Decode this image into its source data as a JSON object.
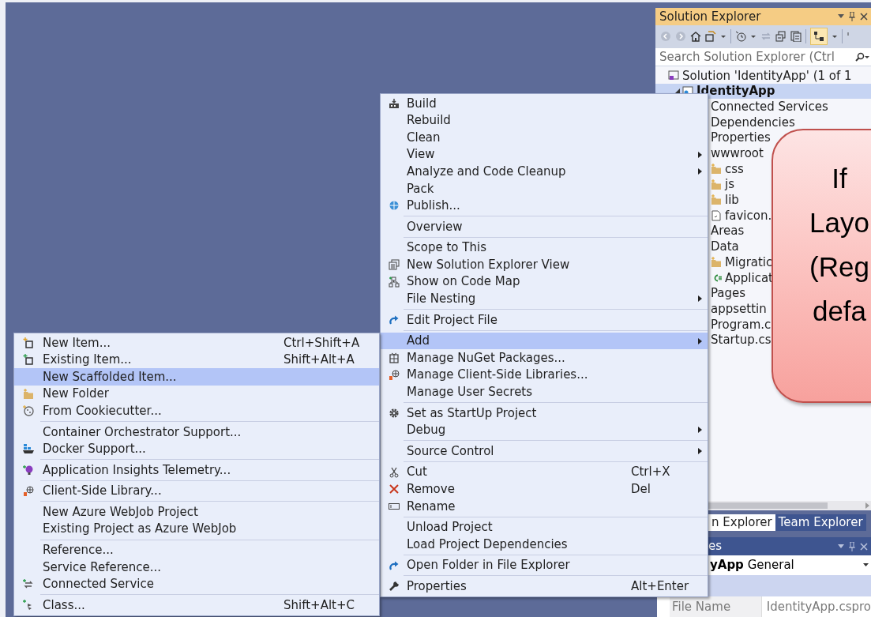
{
  "solution_explorer": {
    "title": "Solution Explorer",
    "search": {
      "placeholder": "Search Solution Explorer (Ctrl"
    },
    "tree": [
      {
        "label": "Solution 'IdentityApp' (1 of 1",
        "selected": false,
        "children": [
          {
            "label": "IdentityApp",
            "selected": true,
            "children": [
              {
                "label": "Connected Services",
                "selected": false
              },
              {
                "label": "Dependencies",
                "selected": false
              },
              {
                "label": "Properties",
                "selected": false
              },
              {
                "label": "wwwroot",
                "selected": false,
                "children": [
                  {
                    "label": "css",
                    "selected": false
                  },
                  {
                    "label": "js",
                    "selected": false
                  },
                  {
                    "label": "lib",
                    "selected": false
                  },
                  {
                    "label": "favicon.",
                    "selected": false
                  }
                ]
              },
              {
                "label": "Areas",
                "selected": false
              },
              {
                "label": "Data",
                "selected": false,
                "children": [
                  {
                    "label": "Migratic",
                    "selected": false
                  },
                  {
                    "label": "Applicat",
                    "selected": false
                  }
                ]
              },
              {
                "label": "Pages",
                "selected": false
              },
              {
                "label": "appsettin",
                "selected": false
              },
              {
                "label": "Program.c",
                "selected": false
              },
              {
                "label": "Startup.cs",
                "selected": false
              }
            ]
          }
        ]
      }
    ]
  },
  "tabs": [
    {
      "label": "n Explorer",
      "selected": true
    },
    {
      "label": "Team Explorer",
      "selected": false
    }
  ],
  "properties": {
    "title": "es",
    "object": "**yApp** General",
    "rows": [
      {
        "name": "File Name",
        "value": "IdentityApp.cspro"
      }
    ]
  },
  "context_menu": {
    "items": [
      {
        "kind": "item",
        "label": "Build",
        "submenu": false,
        "selected": false
      },
      {
        "kind": "item",
        "label": "Rebuild",
        "submenu": false,
        "selected": false
      },
      {
        "kind": "item",
        "label": "Clean",
        "submenu": false,
        "selected": false
      },
      {
        "kind": "item",
        "label": "View",
        "submenu": true,
        "selected": false
      },
      {
        "kind": "item",
        "label": "Analyze and Code Cleanup",
        "submenu": true,
        "selected": false
      },
      {
        "kind": "item",
        "label": "Pack",
        "submenu": false,
        "selected": false
      },
      {
        "kind": "item",
        "label": "Publish...",
        "submenu": false,
        "selected": false
      },
      {
        "kind": "separator"
      },
      {
        "kind": "item",
        "label": "Overview",
        "submenu": false,
        "selected": false
      },
      {
        "kind": "separator"
      },
      {
        "kind": "item",
        "label": "Scope to This",
        "submenu": false,
        "selected": false
      },
      {
        "kind": "item",
        "label": "New Solution Explorer View",
        "submenu": false,
        "selected": false
      },
      {
        "kind": "item",
        "label": "Show on Code Map",
        "submenu": false,
        "selected": false
      },
      {
        "kind": "item",
        "label": "File Nesting",
        "submenu": true,
        "selected": false
      },
      {
        "kind": "separator"
      },
      {
        "kind": "item",
        "label": "Edit Project File",
        "submenu": false,
        "selected": false
      },
      {
        "kind": "separator"
      },
      {
        "kind": "item",
        "label": "Add",
        "submenu": true,
        "selected": true
      },
      {
        "kind": "item",
        "label": "Manage NuGet Packages...",
        "submenu": false,
        "selected": false
      },
      {
        "kind": "item",
        "label": "Manage Client-Side Libraries...",
        "submenu": false,
        "selected": false
      },
      {
        "kind": "item",
        "label": "Manage User Secrets",
        "submenu": false,
        "selected": false
      },
      {
        "kind": "separator"
      },
      {
        "kind": "item",
        "label": "Set as StartUp Project",
        "submenu": false,
        "selected": false
      },
      {
        "kind": "item",
        "label": "Debug",
        "submenu": true,
        "selected": false
      },
      {
        "kind": "separator"
      },
      {
        "kind": "item",
        "label": "Source Control",
        "submenu": true,
        "selected": false
      },
      {
        "kind": "separator"
      },
      {
        "kind": "item",
        "label": "Cut",
        "shortcut": "Ctrl+X",
        "submenu": false,
        "selected": false
      },
      {
        "kind": "item",
        "label": "Remove",
        "shortcut": "Del",
        "submenu": false,
        "selected": false
      },
      {
        "kind": "item",
        "label": "Rename",
        "submenu": false,
        "selected": false
      },
      {
        "kind": "separator"
      },
      {
        "kind": "item",
        "label": "Unload Project",
        "submenu": false,
        "selected": false
      },
      {
        "kind": "item",
        "label": "Load Project Dependencies",
        "submenu": false,
        "selected": false
      },
      {
        "kind": "separator"
      },
      {
        "kind": "item",
        "label": "Open Folder in File Explorer",
        "submenu": false,
        "selected": false
      },
      {
        "kind": "separator"
      },
      {
        "kind": "item",
        "label": "Properties",
        "shortcut": "Alt+Enter",
        "submenu": false,
        "selected": false
      }
    ]
  },
  "add_submenu": {
    "items": [
      {
        "kind": "item",
        "label": "New Item...",
        "shortcut": "Ctrl+Shift+A",
        "selected": false
      },
      {
        "kind": "item",
        "label": "Existing Item...",
        "shortcut": "Shift+Alt+A",
        "selected": false
      },
      {
        "kind": "item",
        "label": "New Scaffolded Item...",
        "selected": true
      },
      {
        "kind": "item",
        "label": "New Folder",
        "selected": false
      },
      {
        "kind": "item",
        "label": "From Cookiecutter...",
        "selected": false
      },
      {
        "kind": "separator"
      },
      {
        "kind": "item",
        "label": "Container Orchestrator Support...",
        "selected": false
      },
      {
        "kind": "item",
        "label": "Docker Support...",
        "selected": false
      },
      {
        "kind": "separator"
      },
      {
        "kind": "item",
        "label": "Application Insights Telemetry...",
        "selected": false
      },
      {
        "kind": "separator"
      },
      {
        "kind": "item",
        "label": "Client-Side Library...",
        "selected": false
      },
      {
        "kind": "separator"
      },
      {
        "kind": "item",
        "label": "New Azure WebJob Project",
        "selected": false
      },
      {
        "kind": "item",
        "label": "Existing Project as Azure WebJob",
        "selected": false
      },
      {
        "kind": "separator"
      },
      {
        "kind": "item",
        "label": "Reference...",
        "selected": false
      },
      {
        "kind": "item",
        "label": "Service Reference...",
        "selected": false
      },
      {
        "kind": "item",
        "label": "Connected Service",
        "selected": false
      },
      {
        "kind": "separator"
      },
      {
        "kind": "item",
        "label": "Class...",
        "shortcut": "Shift+Alt+C",
        "selected": false
      }
    ]
  },
  "callout": {
    "lines": [
      "If",
      "Layo",
      "(Reg",
      "defa"
    ]
  }
}
